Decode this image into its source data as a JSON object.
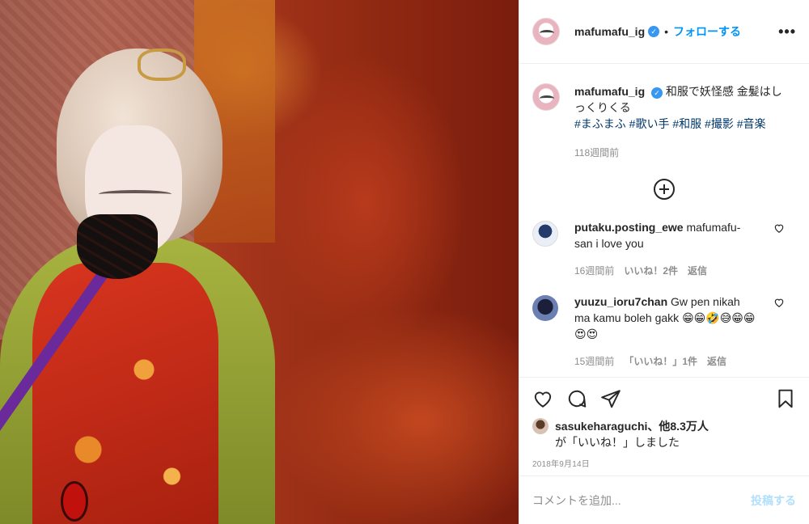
{
  "header": {
    "username": "mafumafu_ig",
    "separator": "•",
    "follow_label": "フォローする",
    "more_label": "•••"
  },
  "caption": {
    "username": "mafumafu_ig",
    "text": "和服で妖怪感 金髪はしっくりくる",
    "hashtags": "#まふまふ #歌い手 #和服 #撮影 #音楽",
    "time": "118週間前"
  },
  "comments": [
    {
      "username": "putaku.posting_ewe",
      "text": "mafumafu-san i love you",
      "time": "16週間前",
      "likes": "いいね！2件",
      "reply": "返信"
    },
    {
      "username": "yuuzu_ioru7chan",
      "text": "Gw pen nikah ma kamu boleh gakk 😁😁🤣😅😁😁😍😍",
      "time": "15週間前",
      "likes": "「いいね！」1件",
      "reply": "返信"
    }
  ],
  "likes": {
    "user": "sasukeharaguchi",
    "others": "、他8.3万人",
    "suffix": "が「いいね！」しました"
  },
  "post_date": "2018年9月14日",
  "add_comment": {
    "placeholder": "コメントを追加...",
    "post_label": "投稿する"
  },
  "colors": {
    "accent": "#0095f6",
    "verified": "#3897f0",
    "hashtag": "#00376b",
    "muted": "#8e8e8e",
    "post_disabled": "#b2dffc"
  }
}
